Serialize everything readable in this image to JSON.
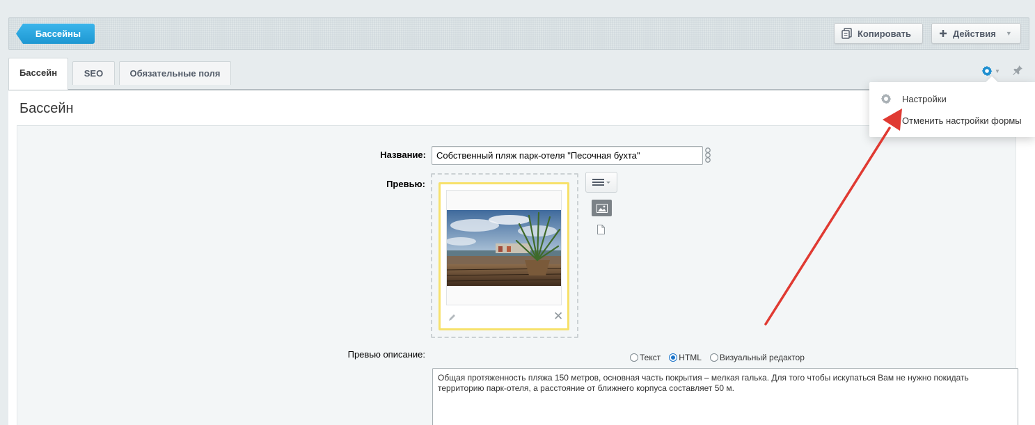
{
  "toolbar": {
    "back_label": "Бассейны",
    "copy_label": "Копировать",
    "actions_label": "Действия"
  },
  "tabs": [
    {
      "label": "Бассейн",
      "active": true
    },
    {
      "label": "SEO",
      "active": false
    },
    {
      "label": "Обязательные поля",
      "active": false
    }
  ],
  "form": {
    "title": "Бассейн",
    "name_label": "Название:",
    "name_value": "Собственный пляж парк-отеля \"Песочная бухта\"",
    "preview_label": "Превью:",
    "preview_desc_label": "Превью описание:",
    "desc_type_options": [
      {
        "label": "Текст",
        "checked": false
      },
      {
        "label": "HTML",
        "checked": true
      },
      {
        "label": "Визуальный редактор",
        "checked": false
      }
    ],
    "preview_desc_value": "Общая протяженность пляжа 150 метров, основная часть покрытия – мелкая галька. Для того чтобы искупаться Вам не нужно покидать территорию парк-отеля, а расстояние от ближнего корпуса составляет 50 м."
  },
  "settings_menu": {
    "items": [
      {
        "label": "Настройки",
        "icon": "gear-icon"
      },
      {
        "label": "Отменить настройки формы",
        "icon": ""
      }
    ]
  },
  "colors": {
    "accent": "#1e97d2",
    "annotation_arrow": "#e03a32",
    "image_card_border": "#f7e16b"
  }
}
